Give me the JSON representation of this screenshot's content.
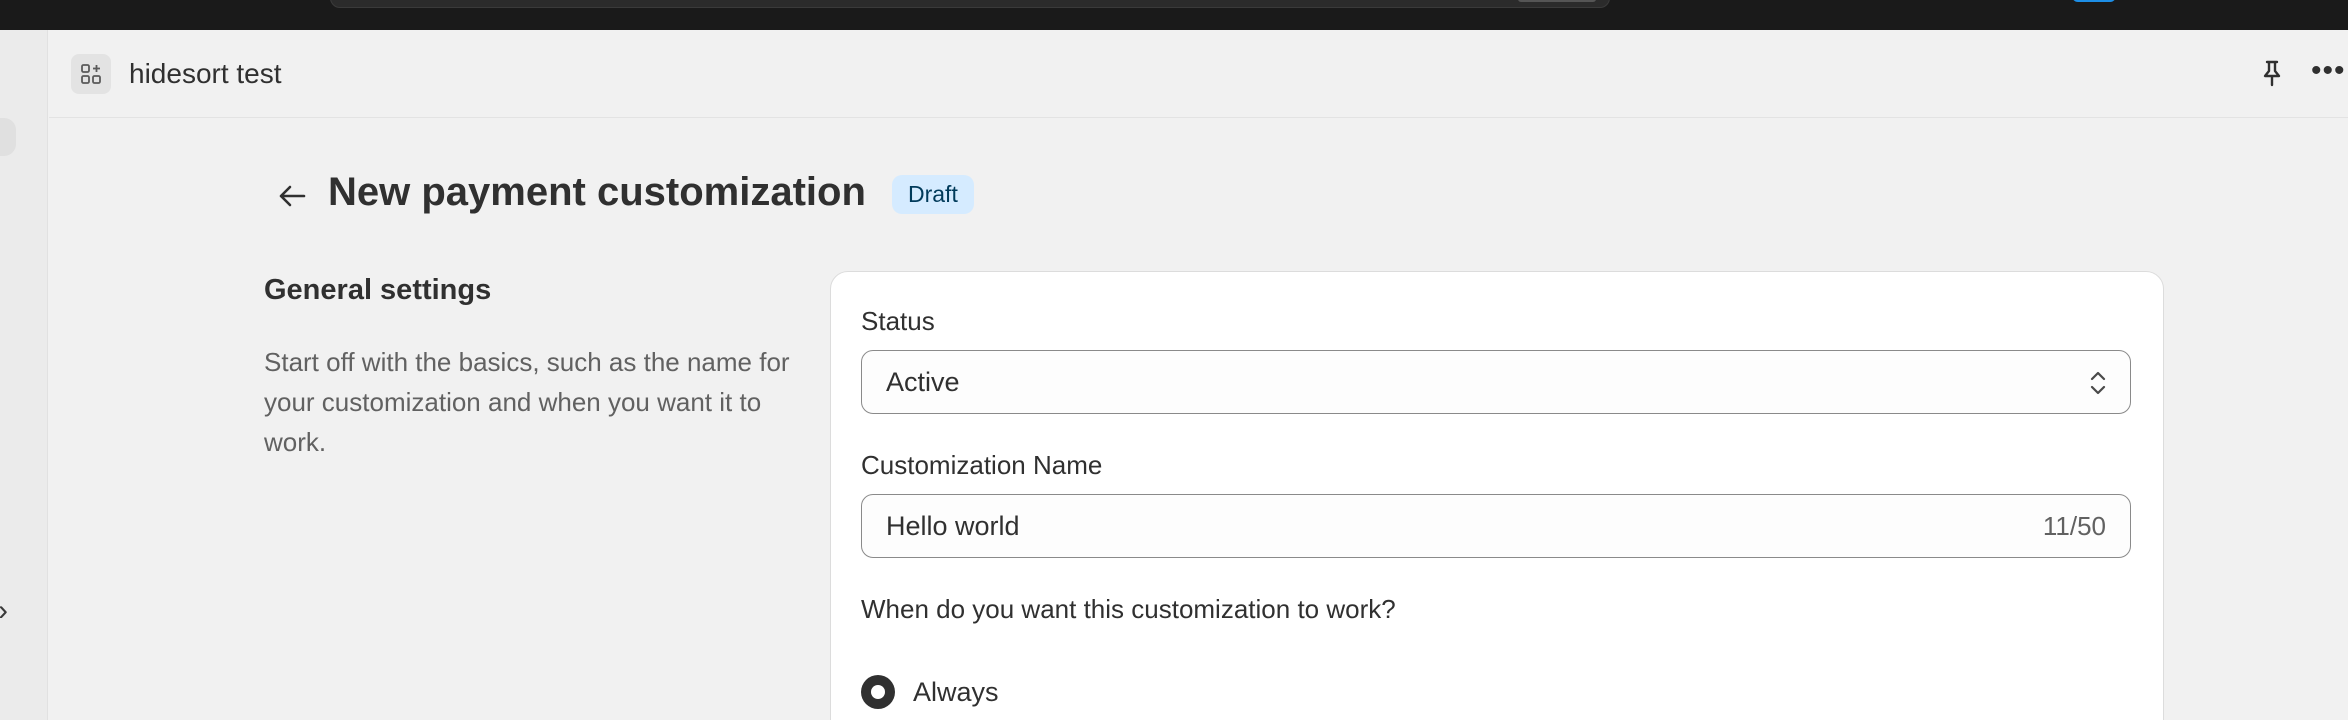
{
  "app": {
    "title": "hidesort test"
  },
  "page": {
    "title": "New payment customization",
    "status_badge": "Draft"
  },
  "general_settings": {
    "title": "General settings",
    "description": "Start off with the basics, such as the name for your customization and when you want it to work."
  },
  "form": {
    "status": {
      "label": "Status",
      "value": "Active"
    },
    "name": {
      "label": "Customization Name",
      "value": "Hello world",
      "char_count": "11/50"
    },
    "schedule": {
      "question": "When do you want this customization to work?",
      "option_always": "Always"
    }
  },
  "icons": {
    "app": "apps-grid-icon",
    "back": "arrow-left-icon",
    "pin": "pin-icon",
    "more": "more-horizontal-icon",
    "select": "chevron-up-down-icon",
    "rail": "chevron-right-icon"
  },
  "colors": {
    "badge_bg": "#d5ebff",
    "accent": "#303030",
    "topbar": "#1a1a1a"
  }
}
